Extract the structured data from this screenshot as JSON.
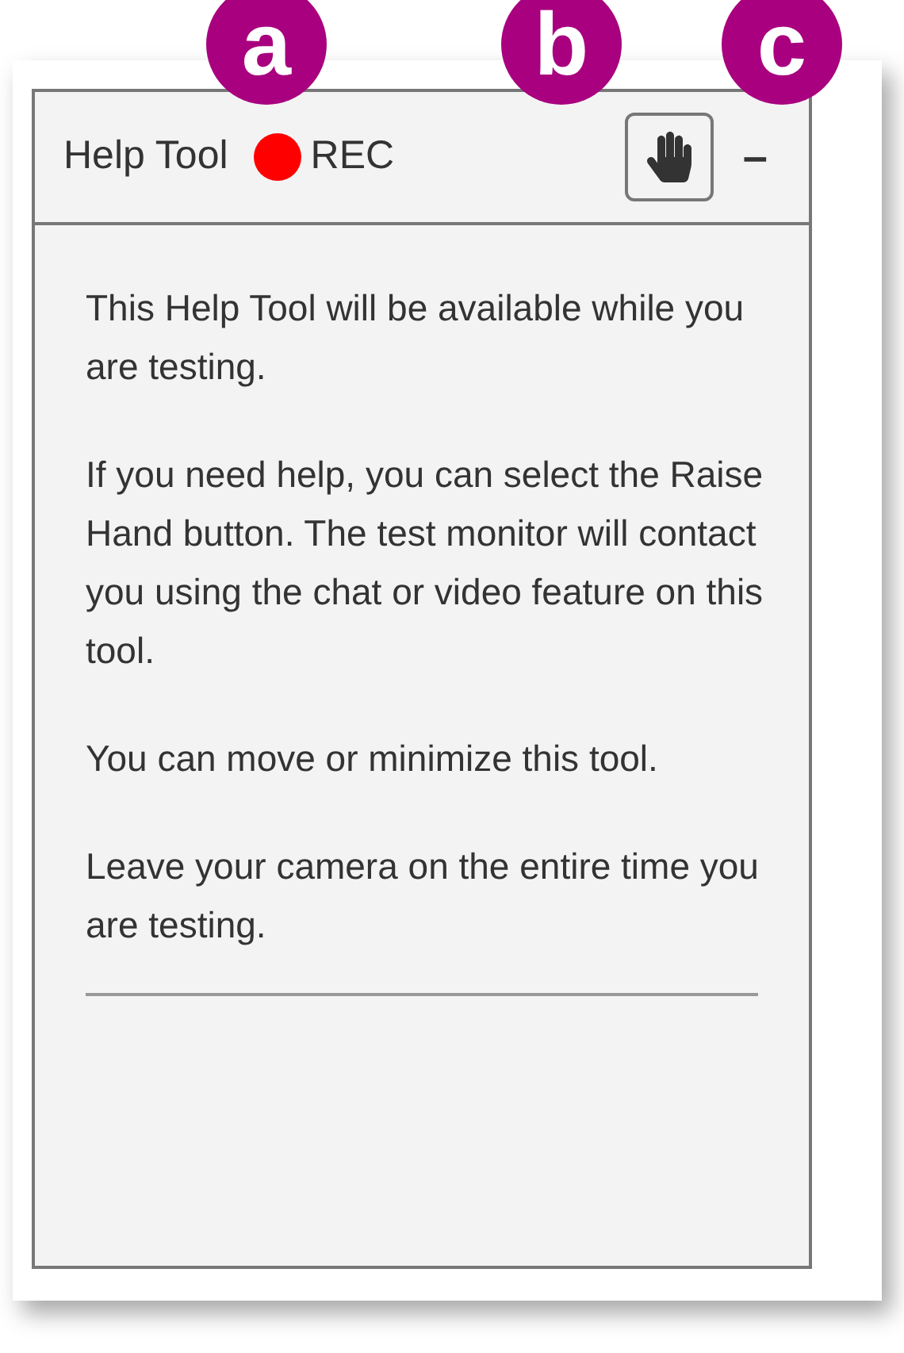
{
  "callouts": [
    {
      "label": "a"
    },
    {
      "label": "b"
    },
    {
      "label": "c"
    }
  ],
  "header": {
    "title": "Help Tool",
    "recording": {
      "on": true,
      "label": "REC"
    },
    "minimize": "–"
  },
  "paragraphs": [
    "This Help Tool will be available while you are testing.",
    "If you need help, you can select the Raise Hand button. The test monitor will contact you using the chat or video feature on this tool.",
    "You can move or minimize this tool.",
    "Leave your camera on the entire time you are testing."
  ]
}
